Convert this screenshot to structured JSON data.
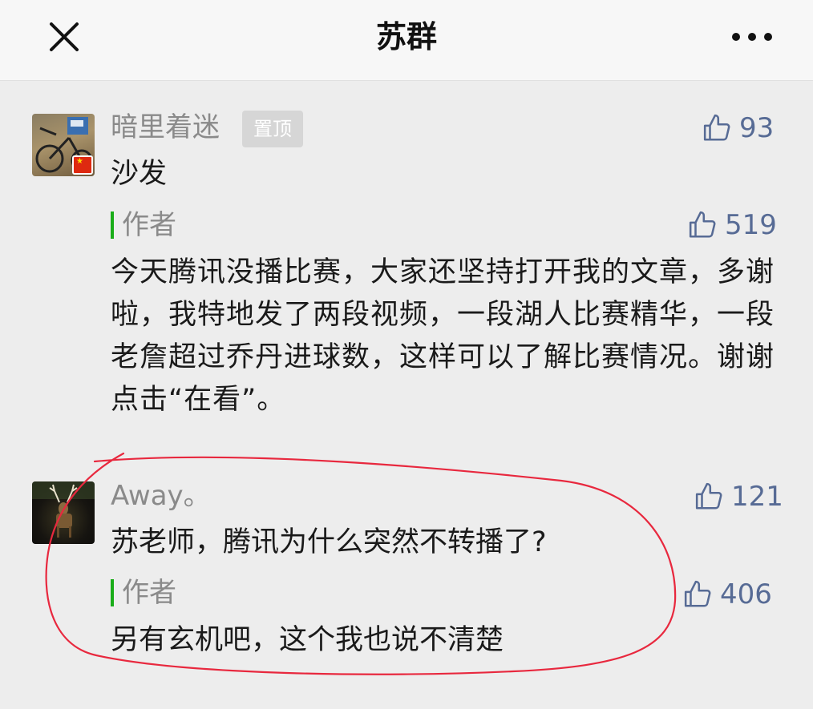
{
  "header": {
    "title": "苏群",
    "close_icon": "close-icon",
    "more_icon": "more-dots-icon"
  },
  "comments": [
    {
      "username": "暗里着迷",
      "pinned_label": "置顶",
      "text": "沙发",
      "likes": "93",
      "reply": {
        "author_label": "作者",
        "text": "今天腾讯没播比赛，大家还坚持打开我的文章，多谢啦，我特地发了两段视频，一段湖人比赛精华，一段老詹超过乔丹进球数，这样可以了解比赛情况。谢谢点击“在看”。",
        "likes": "519"
      }
    },
    {
      "username": "Away。",
      "text": "苏老师，腾讯为什么突然不转播了?",
      "likes": "121",
      "reply": {
        "author_label": "作者",
        "text": "另有玄机吧，这个我也说不清楚",
        "likes": "406"
      }
    }
  ],
  "colors": {
    "accent_link": "#576b95",
    "author_bar": "#1aad19",
    "annotation_circle": "#e8283e",
    "background": "#ededed"
  }
}
